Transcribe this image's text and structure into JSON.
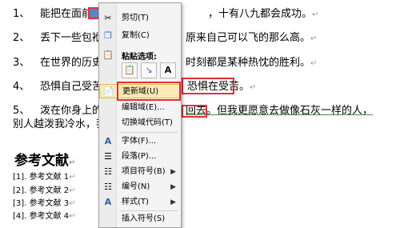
{
  "document": {
    "paragraphs": [
      {
        "num": "1、",
        "left": "能把在面前行",
        "right": "，十有八九都会成功。"
      },
      {
        "num": "2、",
        "left": "丢下一些包袱后",
        "right": "原来自己可以飞的那么高。"
      },
      {
        "num": "3、",
        "left": "在世界的历史中",
        "right": "时刻都是某种热忱的胜利。"
      },
      {
        "num": "4、",
        "left": "恐惧自己受苦的",
        "right": "恐惧在受苦。"
      },
      {
        "num": "5、",
        "left": "泼在你身上的冷",
        "right": "回去。但我更愿意去做像石灰一样的人，"
      }
    ],
    "paragraph5_line2": "别人越泼我冷水，我",
    "paragraph_mark": "↵",
    "heading": "参考文献",
    "references": [
      "[1]. 参考文献 1",
      "[2]. 参考文献 2",
      "[3]. 参考文献 3",
      "[4]. 参考文献 4"
    ]
  },
  "context_menu": {
    "items": {
      "cut": {
        "label": "剪切(T)",
        "icon": "scissors-icon"
      },
      "copy": {
        "label": "复制(C)",
        "icon": "copy-icon"
      },
      "paste_options_label": "粘贴选项:",
      "paste_buttons": [
        "paste-keep-format-icon",
        "paste-merge-format-icon",
        "paste-text-only-icon"
      ],
      "update_field": {
        "label": "更新域(U)",
        "icon": "update-field-icon"
      },
      "edit_field": {
        "label": "编辑域(E)..."
      },
      "toggle_field_codes": {
        "label": "切换域代码(T)"
      },
      "font": {
        "label": "字体(F)...",
        "icon": "font-icon"
      },
      "paragraph": {
        "label": "段落(P)...",
        "icon": "paragraph-icon"
      },
      "bullets": {
        "label": "项目符号(B)",
        "icon": "bullets-icon"
      },
      "numbering": {
        "label": "编号(N)",
        "icon": "numbering-icon"
      },
      "styles": {
        "label": "样式(T)",
        "icon": "styles-icon"
      },
      "insert_symbol": {
        "label": "插入符号(S)"
      }
    },
    "highlight_color": "#e0303a"
  }
}
